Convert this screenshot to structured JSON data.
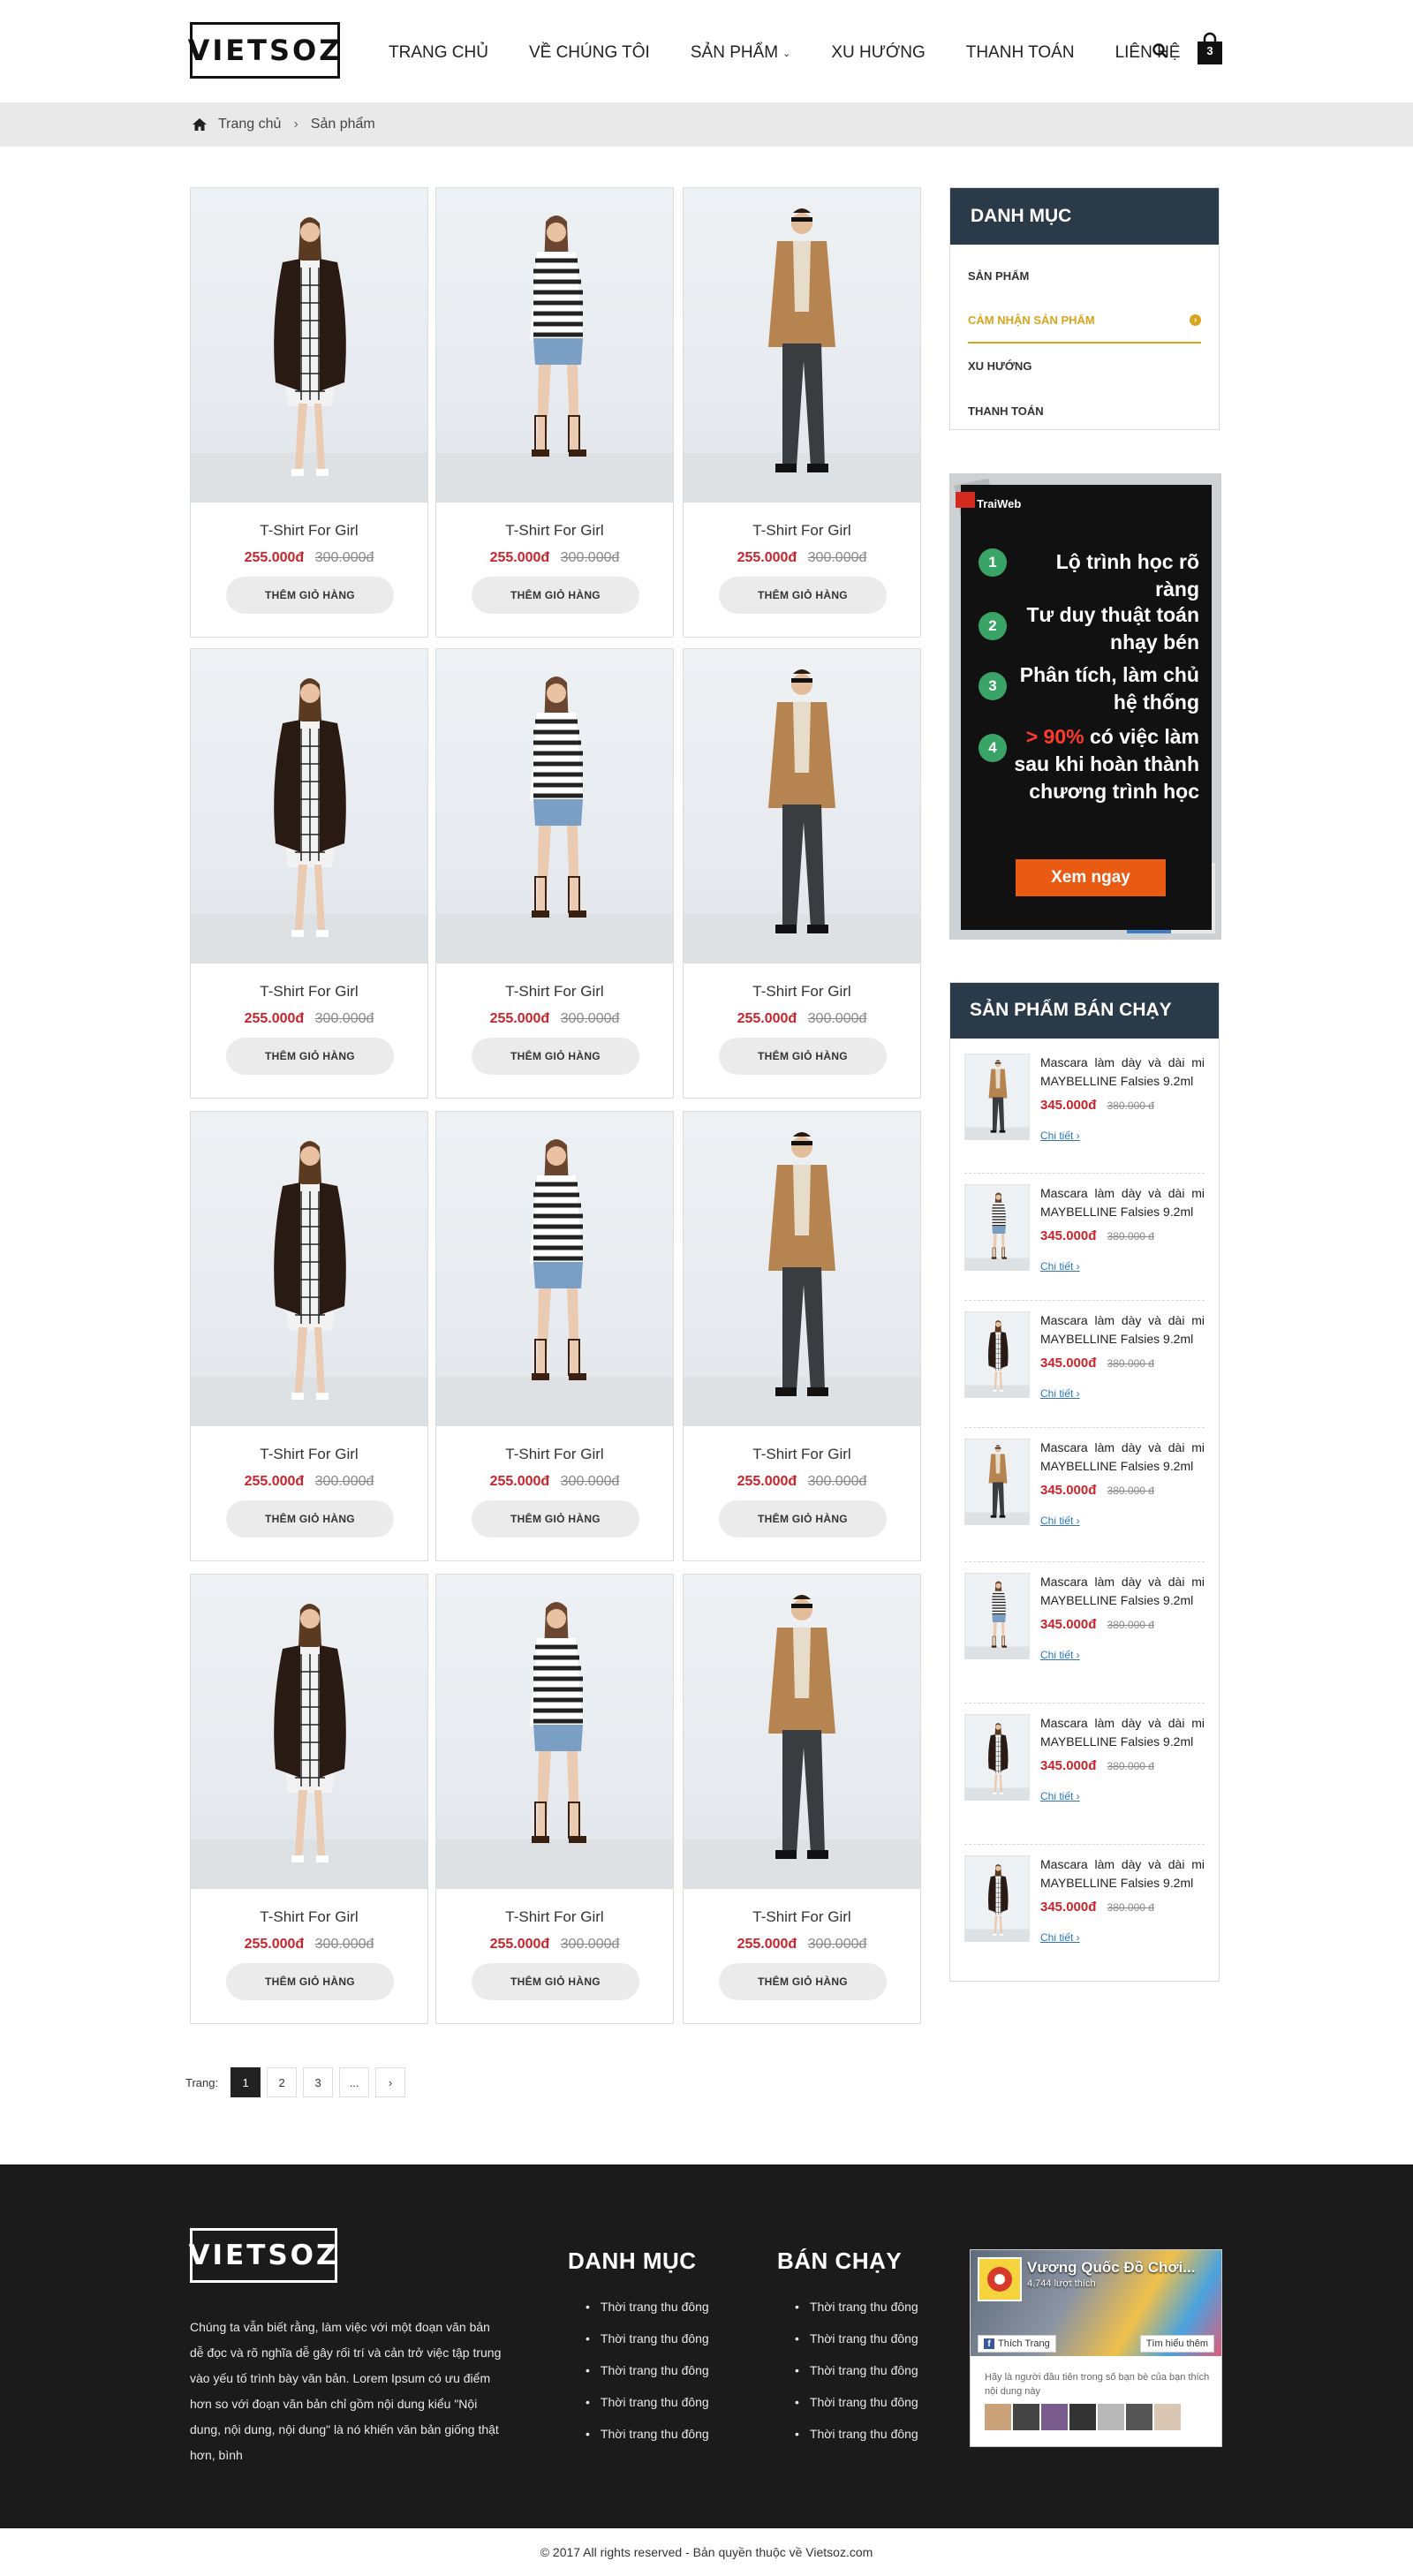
{
  "header": {
    "logo": "VIETSOZ",
    "nav": [
      {
        "label": "TRANG CHỦ"
      },
      {
        "label": "VỀ CHÚNG TÔI"
      },
      {
        "label": "SẢN PHẨM",
        "caret": "⌄"
      },
      {
        "label": "XU HƯỚNG"
      },
      {
        "label": "THANH TOÁN"
      },
      {
        "label": "LIÊN HỆ"
      }
    ],
    "cart_count": "3"
  },
  "breadcrumb": {
    "home": "Trang chủ",
    "separator": "›",
    "current": "Sản phẩm"
  },
  "products": {
    "name": "T-Shirt For Girl",
    "price": "255.000đ",
    "old_price": "300.000đ",
    "button": "THÊM GIỎ HÀNG",
    "models": [
      "girl-blazer",
      "girl-stripes",
      "man-coat"
    ]
  },
  "category": {
    "title": "DANH MỤC",
    "items": [
      {
        "label": "SẢN PHẨM",
        "active": false
      },
      {
        "label": "CẢM NHẬN SẢN PHẨM",
        "active": true
      },
      {
        "label": "XU HƯỚNG",
        "active": false
      },
      {
        "label": "THANH TOÁN",
        "active": false
      }
    ]
  },
  "ad": {
    "brand": "TraiWeb",
    "steps": [
      {
        "num": "1",
        "text": "Lộ trình học rõ ràng"
      },
      {
        "num": "2",
        "text": "Tư duy thuật toán nhạy bén"
      },
      {
        "num": "3",
        "text": "Phân tích, làm chủ hệ thống"
      },
      {
        "num": "4",
        "highlight": "> 90%",
        "text": "có việc làm sau khi hoàn thành chương trình học"
      }
    ],
    "cta": "Xem ngay"
  },
  "bestseller": {
    "title": "SẢN PHẨM BÁN CHẠY",
    "name": "Mascara làm dày và dài mi MAYBELLINE Falsies 9.2ml",
    "price": "345.000đ",
    "old_price": "380.000 đ",
    "more": "Chi tiết ›",
    "models": [
      "man-coat",
      "girl-stripes",
      "girl-blazer",
      "man-coat",
      "girl-stripes",
      "girl-blazer",
      "girl-blazer"
    ]
  },
  "pagination": {
    "label": "Trang:",
    "pages": [
      "1",
      "2",
      "3",
      "...",
      "›"
    ],
    "active": "1"
  },
  "footer": {
    "logo": "VIETSOZ",
    "about": "Chúng ta vẫn biết rằng, làm việc với một đoạn văn bản dễ đọc và rõ nghĩa dễ gây rối trí và cản trở việc tập trung vào yếu tố trình bày văn bản. Lorem Ipsum có ưu điểm hơn so với đoạn văn bản chỉ gồm nội dung kiểu \"Nội dung, nội dung, nội dung\" là nó khiến văn bản giống thật hơn, bình",
    "col1": {
      "title": "DANH MỤC",
      "items": [
        "Thời trang thu đông",
        "Thời trang thu đông",
        "Thời trang thu đông",
        "Thời trang thu đông",
        "Thời trang thu đông"
      ]
    },
    "col2": {
      "title": "BÁN CHẠY",
      "items": [
        "Thời trang thu đông",
        "Thời trang thu đông",
        "Thời trang thu đông",
        "Thời trang thu đông",
        "Thời trang thu đông"
      ]
    },
    "facebook": {
      "page_name": "Vương Quốc Đồ Chơi...",
      "likes": "4.744 lượt thích",
      "like_btn": "Thích Trang",
      "more_btn": "Tìm hiểu thêm",
      "text": "Hãy là người đầu tiên trong số bạn bè của bạn thích nội dung này"
    }
  },
  "copyright": "© 2017  All rights reserved -  Bản quyền thuộc về Vietsoz.com",
  "colors": {
    "accent": "#d9a41d",
    "price": "#c8242b",
    "sidebar_head": "#2b3a48",
    "footer_bg": "#1b1b1b"
  }
}
